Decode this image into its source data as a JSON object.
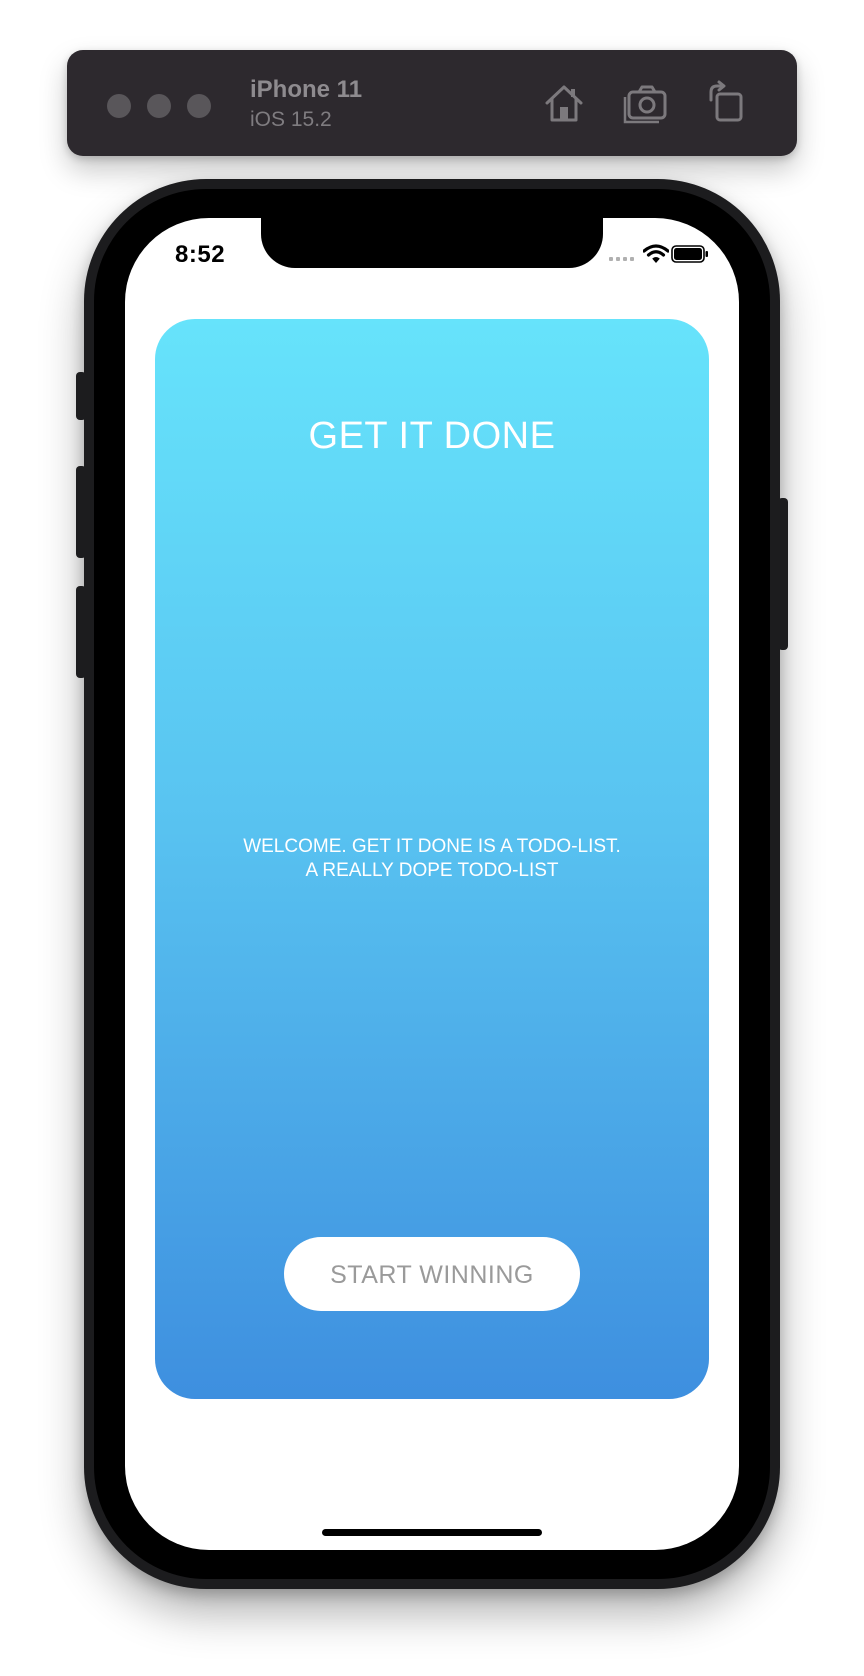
{
  "simulator": {
    "device_name": "iPhone 11",
    "os_version": "iOS 15.2",
    "toolbar_buttons": [
      {
        "icon": "home-icon"
      },
      {
        "icon": "screenshot-camera-icon"
      },
      {
        "icon": "rotate-icon"
      }
    ]
  },
  "status_bar": {
    "time": "8:52",
    "icons": [
      "cellular-signal-icon",
      "wifi-icon",
      "battery-icon"
    ]
  },
  "app": {
    "title": "GET IT DONE",
    "welcome_lines": [
      "WELCOME. GET IT DONE IS A TODO-LIST.",
      "A REALLY DOPE TODO-LIST"
    ],
    "start_button_label": "START WINNING"
  },
  "colors": {
    "gradient_top": "#66e3fb",
    "gradient_bottom": "#3e8fdf",
    "toolbar_bg": "#2d292e",
    "button_text": "#9a9a9a"
  }
}
